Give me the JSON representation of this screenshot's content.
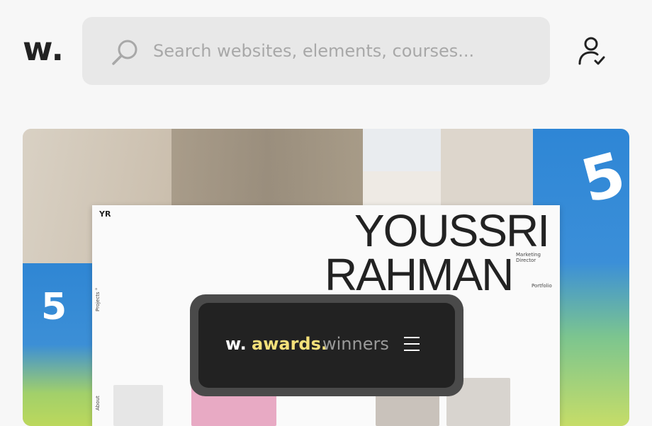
{
  "header": {
    "logo": "w.",
    "search": {
      "placeholder": "Search websites, elements, courses..."
    },
    "user_icon": "user-check-icon"
  },
  "hero": {
    "poster": {
      "monogram": "YR",
      "name_line1": "YOUSSRI",
      "name_line2": "RAHMAN",
      "role": "Marketing Director",
      "portfolio": "Portfolio",
      "side_label_top": "Projects °",
      "side_label_bottom": "About"
    },
    "sign_digit": "5"
  },
  "awards_bar": {
    "logo": "w.",
    "awards": "awards.",
    "winners": "winners",
    "menu_icon": "hamburger-icon"
  },
  "colors": {
    "background": "#f7f7f7",
    "search_bg": "#e8e8e8",
    "awards_bg": "#222222",
    "awards_accent": "#f4e07a"
  }
}
